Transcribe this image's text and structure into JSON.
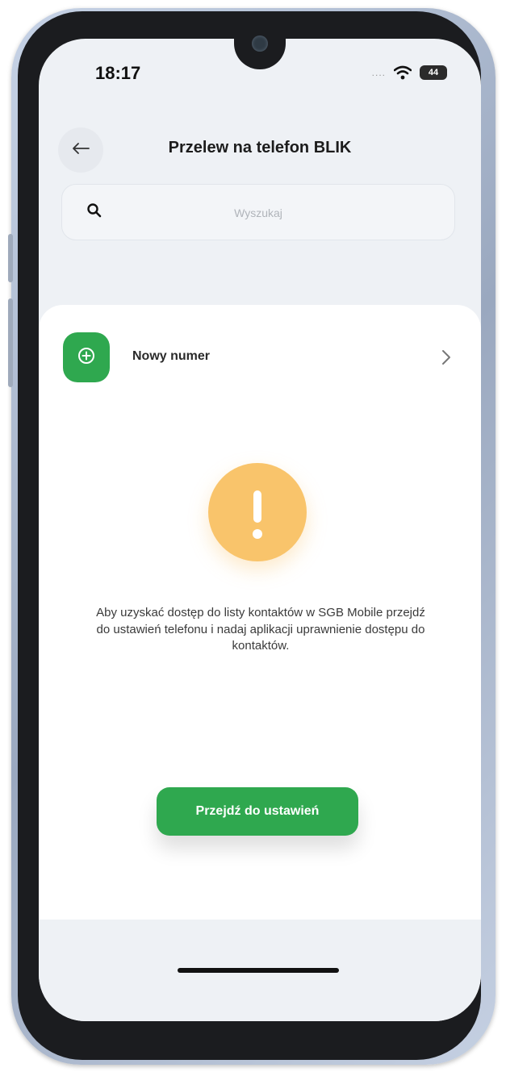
{
  "status_bar": {
    "time": "18:17",
    "signal": "....",
    "battery": "44"
  },
  "header": {
    "back_icon": "arrow-left-icon",
    "title": "Przelew na telefon BLIK"
  },
  "search": {
    "icon": "search-icon",
    "placeholder": "Wyszukaj"
  },
  "new_number": {
    "icon": "plus-circle-icon",
    "label": "Nowy numer",
    "chevron_icon": "chevron-right-icon"
  },
  "warning": {
    "icon": "exclamation-icon",
    "message": "Aby uzyskać dostęp do listy kontaktów w SGB Mobile przejdź do ustawień telefonu i nadaj aplikacji uprawnienie dostępu do kontaktów."
  },
  "cta": {
    "label": "Przejdź do ustawień"
  },
  "colors": {
    "accent_green": "#2fa84f",
    "warning_yellow": "#f9c46b",
    "background": "#eef1f5"
  }
}
